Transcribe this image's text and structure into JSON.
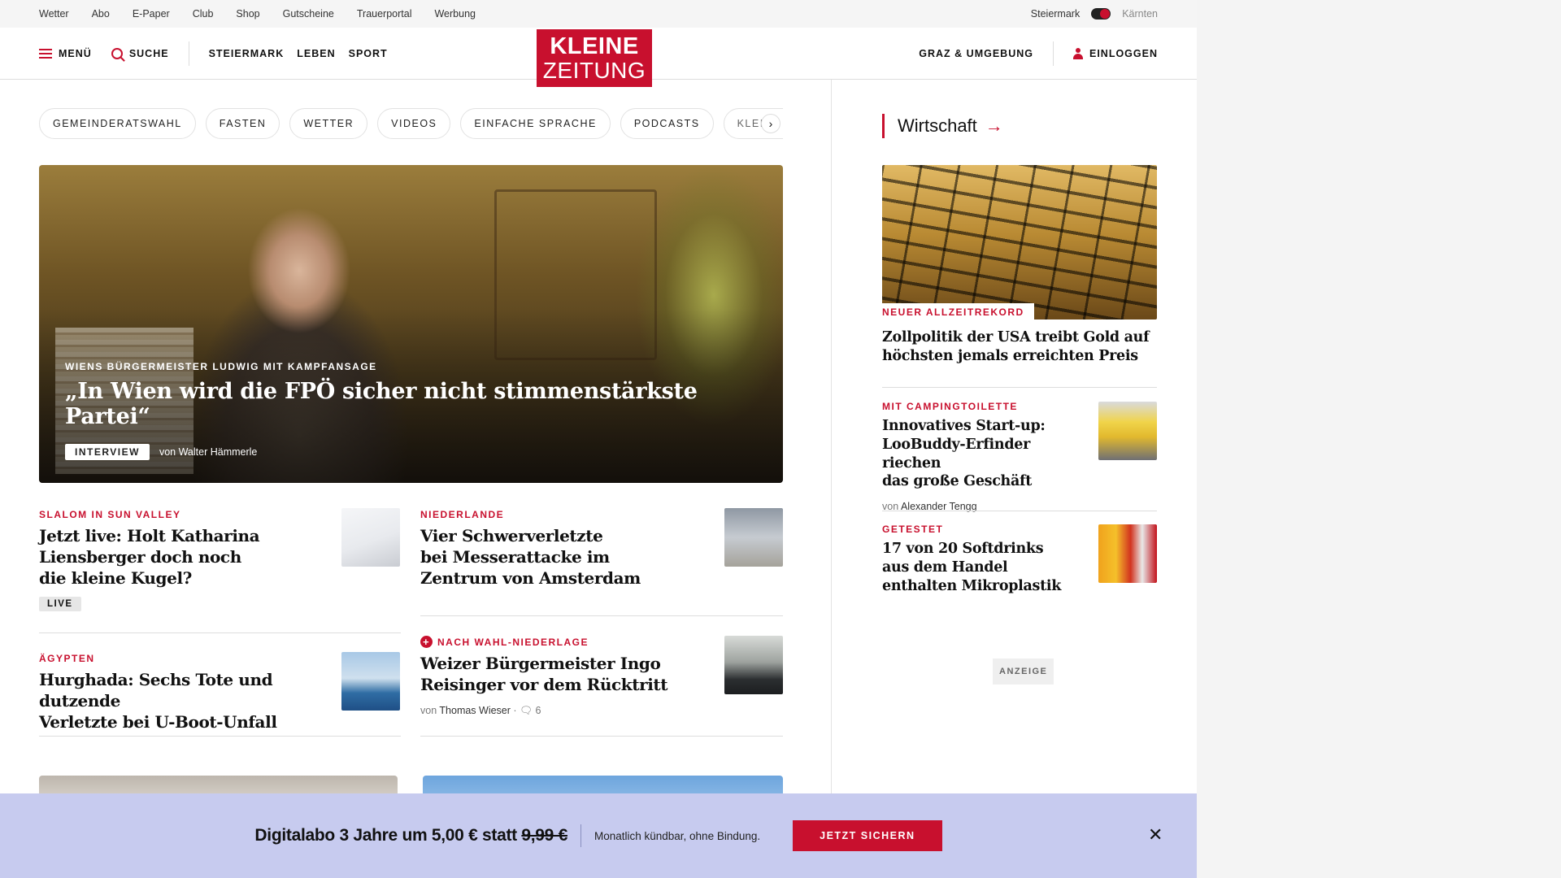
{
  "topbar": {
    "links": [
      "Wetter",
      "Abo",
      "E-Paper",
      "Club",
      "Shop",
      "Gutscheine",
      "Trauerportal",
      "Werbung"
    ],
    "region_active": "Steiermark",
    "region_other": "Kärnten"
  },
  "header": {
    "menu_label": "MENÜ",
    "search_label": "SUCHE",
    "nav": [
      "STEIERMARK",
      "LEBEN",
      "SPORT"
    ],
    "logo_line1": "KLEINE",
    "logo_line2": "ZEITUNG",
    "region_link": "GRAZ & UMGEBUNG",
    "login_label": "EINLOGGEN"
  },
  "chips": [
    "GEMEINDERATSWAHL",
    "FASTEN",
    "WETTER",
    "VIDEOS",
    "EINFACHE SPRACHE",
    "PODCASTS",
    "KLEINE KINDE"
  ],
  "hero": {
    "kicker": "WIENS BÜRGERMEISTER LUDWIG MIT KAMPFANSAGE",
    "title": "„In Wien wird die FPÖ sicher nicht stimmenstärkste Partei“",
    "badge": "INTERVIEW",
    "byline_prefix": "von",
    "author": "Walter Hämmerle"
  },
  "teasers": [
    {
      "kicker": "SLALOM IN SUN VALLEY",
      "title_lines": [
        "Jetzt live: Holt Katharina",
        "Liensberger doch noch",
        "die kleine Kugel?"
      ],
      "badge": "LIVE"
    },
    {
      "kicker": "NIEDERLANDE",
      "title_lines": [
        "Vier Schwerverletzte",
        "bei Messerattacke im",
        "Zentrum von Amsterdam"
      ]
    },
    {
      "kicker": "ÄGYPTEN",
      "title_lines": [
        "Hurghada: Sechs Tote und dutzende",
        "Verletzte bei U-Boot-Unfall"
      ]
    },
    {
      "kicker": "NACH WAHL-NIEDERLAGE",
      "title_lines": [
        "Weizer Bürgermeister Ingo",
        "Reisinger vor dem Rücktritt"
      ],
      "byline_prefix": "von",
      "author": "Thomas Wieser",
      "comments": "6"
    }
  ],
  "sidebar": {
    "section": "Wirtschaft",
    "items": [
      {
        "kicker": "NEUER ALLZEITREKORD",
        "title_lines": [
          "Zollpolitik der USA treibt Gold auf",
          "höchsten jemals erreichten Preis"
        ]
      },
      {
        "kicker": "MIT CAMPINGTOILETTE",
        "title_lines": [
          "Innovatives Start-up:",
          "LooBuddy-Erfinder riechen",
          "das große Geschäft"
        ],
        "byline_prefix": "von",
        "author": "Alexander Tengg"
      },
      {
        "kicker": "GETESTET",
        "title_lines": [
          "17 von 20 Softdrinks",
          "aus dem Handel",
          "enthalten Mikroplastik"
        ]
      }
    ],
    "ad_label": "ANZEIGE"
  },
  "banner": {
    "offer_text": "Digitalabo 3 Jahre um 5,00 € statt ",
    "old_price": "9,99 €",
    "note": "Monatlich kündbar, ohne Bindung.",
    "cta": "JETZT SICHERN"
  },
  "colors": {
    "brand_red": "#c8102e",
    "banner_bg": "#c7cbef"
  }
}
